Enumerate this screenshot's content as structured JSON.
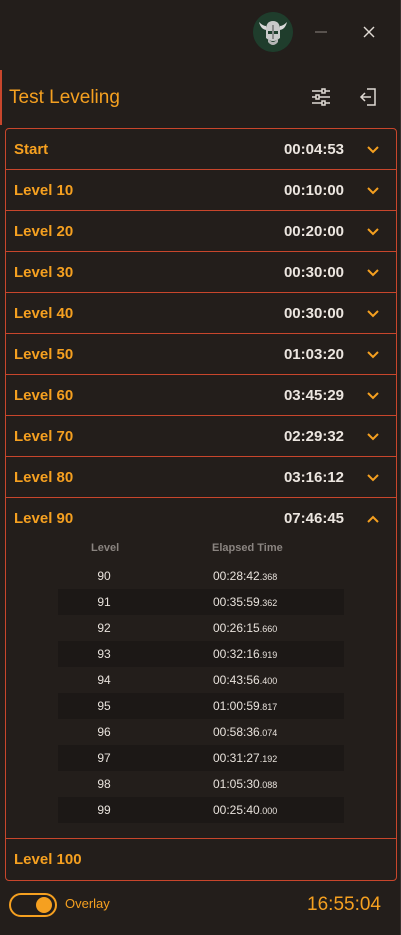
{
  "window": {
    "logo_icon": "viking-helmet-icon",
    "minimize_icon": "minimize-icon",
    "close_icon": "close-icon"
  },
  "header": {
    "title": "Test Leveling",
    "settings_icon": "sliders-icon",
    "exit_icon": "exit-icon"
  },
  "levels": [
    {
      "label": "Start",
      "time": "00:04:53",
      "expanded": false
    },
    {
      "label": "Level 10",
      "time": "00:10:00",
      "expanded": false
    },
    {
      "label": "Level 20",
      "time": "00:20:00",
      "expanded": false
    },
    {
      "label": "Level 30",
      "time": "00:30:00",
      "expanded": false
    },
    {
      "label": "Level 40",
      "time": "00:30:00",
      "expanded": false
    },
    {
      "label": "Level 50",
      "time": "01:03:20",
      "expanded": false
    },
    {
      "label": "Level 60",
      "time": "03:45:29",
      "expanded": false
    },
    {
      "label": "Level 70",
      "time": "02:29:32",
      "expanded": false
    },
    {
      "label": "Level 80",
      "time": "03:16:12",
      "expanded": false
    },
    {
      "label": "Level 90",
      "time": "07:46:45",
      "expanded": true
    },
    {
      "label": "Level 100",
      "time": "",
      "expanded": false
    }
  ],
  "detail": {
    "col_level": "Level",
    "col_elapsed": "Elapsed Time",
    "rows": [
      {
        "level": "90",
        "time": "00:28:42",
        "ms": ".368"
      },
      {
        "level": "91",
        "time": "00:35:59",
        "ms": ".362"
      },
      {
        "level": "92",
        "time": "00:26:15",
        "ms": ".660"
      },
      {
        "level": "93",
        "time": "00:32:16",
        "ms": ".919"
      },
      {
        "level": "94",
        "time": "00:43:56",
        "ms": ".400"
      },
      {
        "level": "95",
        "time": "01:00:59",
        "ms": ".817"
      },
      {
        "level": "96",
        "time": "00:58:36",
        "ms": ".074"
      },
      {
        "level": "97",
        "time": "00:31:27",
        "ms": ".192"
      },
      {
        "level": "98",
        "time": "01:05:30",
        "ms": ".088"
      },
      {
        "level": "99",
        "time": "00:25:40",
        "ms": ".000"
      }
    ]
  },
  "footer": {
    "overlay_label": "Overlay",
    "overlay_on": true,
    "clock": "16:55:04"
  },
  "colors": {
    "accent": "#f5a020",
    "border": "#c8462c",
    "background": "#231e1b",
    "text": "#ece6e0"
  }
}
